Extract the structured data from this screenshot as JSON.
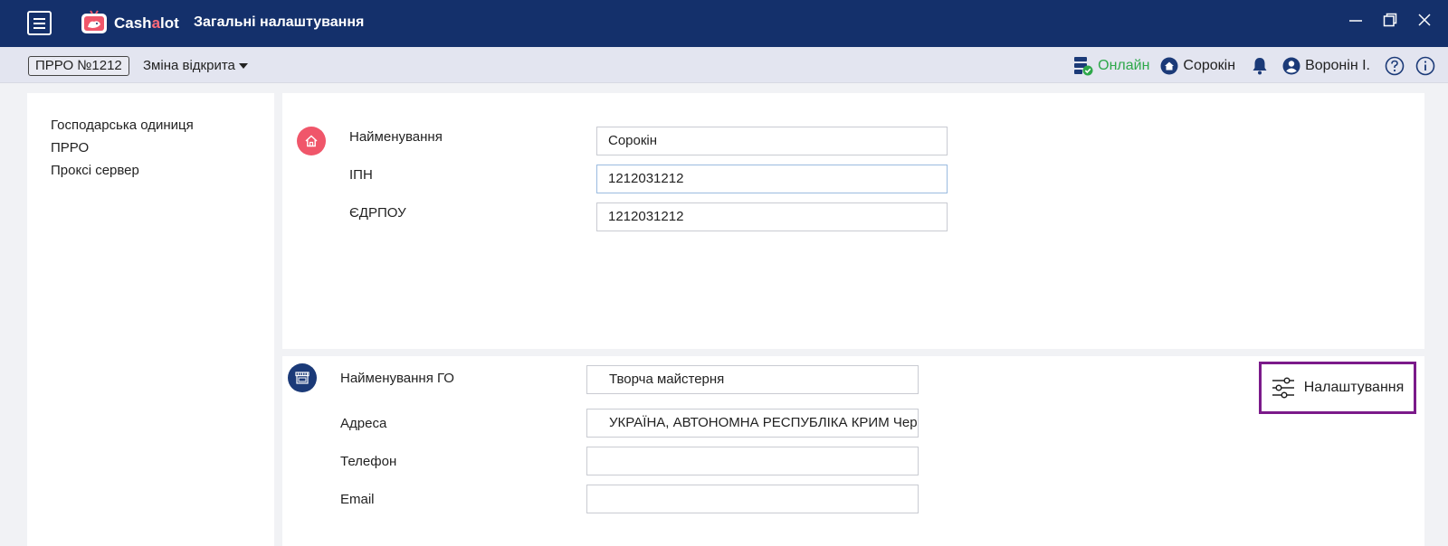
{
  "app": {
    "logo_text_main": "Cash",
    "logo_text_accent": "a",
    "logo_text_end": "lot",
    "title": "Загальні налаштування"
  },
  "toolbar": {
    "prro": "ПРРО №1212",
    "shift": "Зміна відкрита",
    "status": "Онлайн",
    "store": "Сорокін",
    "user": "Воронін І."
  },
  "sidebar": {
    "items": [
      {
        "label": "Господарська одиниця"
      },
      {
        "label": "ПРРО"
      },
      {
        "label": "Проксі сервер"
      }
    ]
  },
  "company": {
    "name_label": "Найменування",
    "name_value": "Сорокін",
    "ipn_label": "ІПН",
    "ipn_value": "1212031212",
    "edrpou_label": "ЄДРПОУ",
    "edrpou_value": "1212031212"
  },
  "unit": {
    "name_label": "Найменування ГО",
    "name_value": "Творча майстерня",
    "address_label": "Адреса",
    "address_value": "УКРАЇНА, АВТОНОМНА РЕСПУБЛІКА КРИМ Чер",
    "phone_label": "Телефон",
    "phone_value": "",
    "email_label": "Email",
    "email_value": "",
    "settings_label": "Налаштування"
  },
  "colors": {
    "titlebar": "#14306b",
    "online": "#2ea84a",
    "company_icon": "#f0566a",
    "unit_icon": "#1b3a78",
    "highlight": "#7b1a8a"
  },
  "icons": {
    "menu": "hamburger-icon",
    "status": "server-check-icon",
    "store": "home-icon",
    "notifications": "bell-icon",
    "user": "user-circle-icon",
    "help": "question-icon",
    "info": "info-icon",
    "company": "home-icon",
    "unit": "store-icon",
    "settings": "sliders-icon"
  }
}
